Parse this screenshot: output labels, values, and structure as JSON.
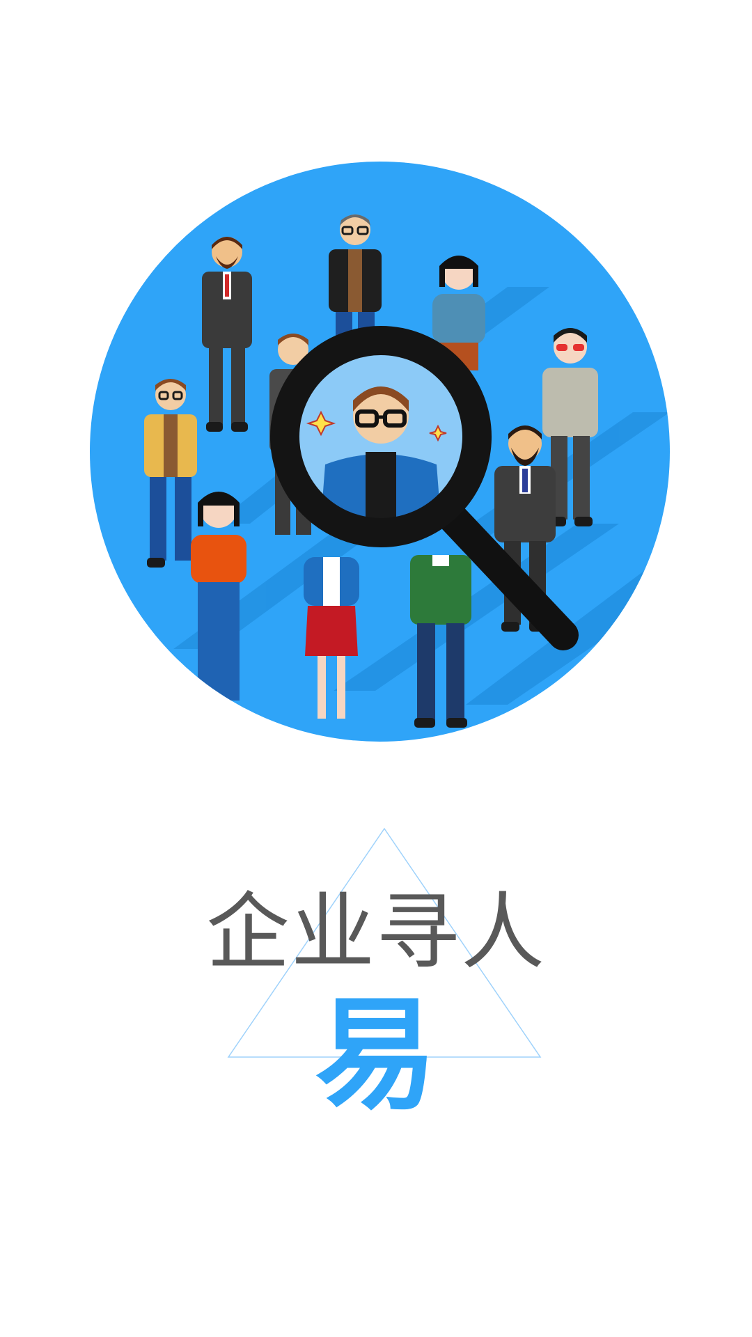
{
  "splash": {
    "tagline": "企业寻人",
    "accent_char": "易"
  },
  "colors": {
    "background": "#ffffff",
    "accent": "#2fa4f8",
    "tagline": "#595959",
    "triangle_outline": "#9fd2fb"
  },
  "illustration": {
    "icon": "people-search-magnifier-icon"
  }
}
